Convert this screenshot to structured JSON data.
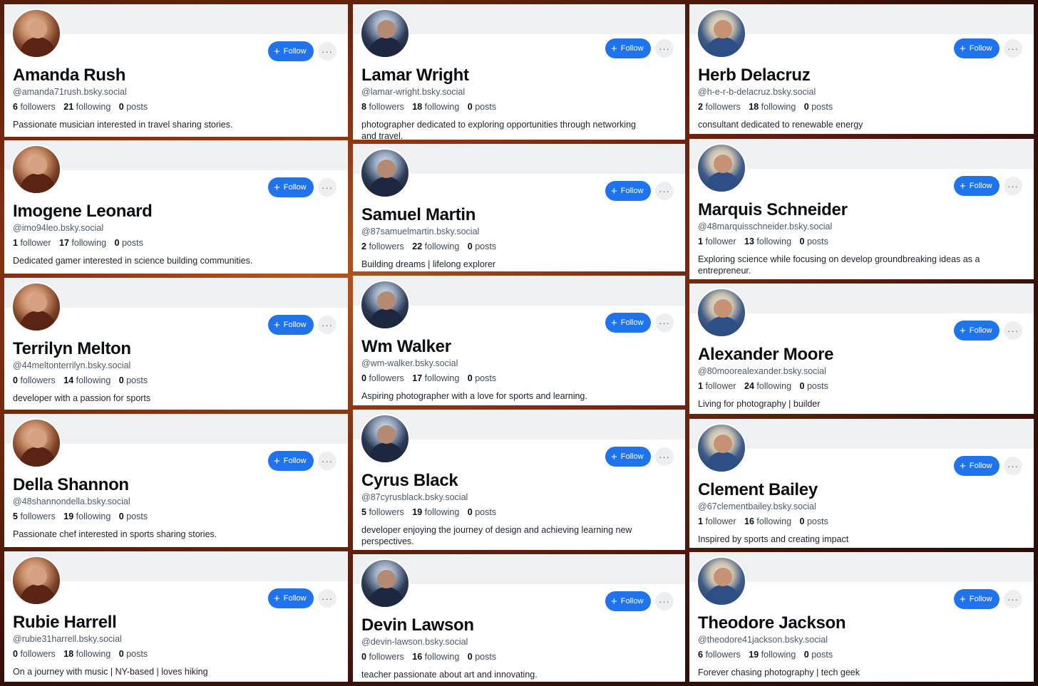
{
  "follow_label": "Follow",
  "more_label": "···",
  "plus_label": "+",
  "stat_labels": {
    "followers": "followers",
    "follower": "follower",
    "following": "following",
    "posts": "posts"
  },
  "colors": {
    "accent": "#1f74ee",
    "banner": "#eef0f2",
    "card": "#ffffff"
  },
  "profiles": [
    {
      "name": "Amanda Rush",
      "handle": "@amanda71rush.bsky.social",
      "followers": "6",
      "followers_label": "followers",
      "following": "21",
      "posts": "0",
      "bio": "Passionate musician interested in travel sharing stories."
    },
    {
      "name": "Imogene Leonard",
      "handle": "@imo94leo.bsky.social",
      "followers": "1",
      "followers_label": "follower",
      "following": "17",
      "posts": "0",
      "bio": "Dedicated gamer interested in science building communities."
    },
    {
      "name": "Terrilyn Melton",
      "handle": "@44meltonterrilyn.bsky.social",
      "followers": "0",
      "followers_label": "followers",
      "following": "14",
      "posts": "0",
      "bio": "developer with a passion for sports"
    },
    {
      "name": "Della Shannon",
      "handle": "@48shannondella.bsky.social",
      "followers": "5",
      "followers_label": "followers",
      "following": "19",
      "posts": "0",
      "bio": "Passionate chef interested in sports sharing stories."
    },
    {
      "name": "Rubie Harrell",
      "handle": "@rubie31harrell.bsky.social",
      "followers": "0",
      "followers_label": "followers",
      "following": "18",
      "posts": "0",
      "bio": "On a journey with music | NY-based | loves hiking"
    },
    {
      "name": "Lamar Wright",
      "handle": "@lamar-wright.bsky.social",
      "followers": "8",
      "followers_label": "followers",
      "following": "18",
      "posts": "0",
      "bio": "photographer dedicated to exploring opportunities through networking and travel."
    },
    {
      "name": "Samuel Martin",
      "handle": "@87samuelmartin.bsky.social",
      "followers": "2",
      "followers_label": "followers",
      "following": "22",
      "posts": "0",
      "bio": "Building dreams | lifelong explorer"
    },
    {
      "name": "Wm Walker",
      "handle": "@wm-walker.bsky.social",
      "followers": "0",
      "followers_label": "followers",
      "following": "17",
      "posts": "0",
      "bio": "Aspiring photographer with a love for sports and learning."
    },
    {
      "name": "Cyrus Black",
      "handle": "@87cyrusblack.bsky.social",
      "followers": "5",
      "followers_label": "followers",
      "following": "19",
      "posts": "0",
      "bio": "developer enjoying the journey of design and achieving learning new perspectives."
    },
    {
      "name": "Devin Lawson",
      "handle": "@devin-lawson.bsky.social",
      "followers": "0",
      "followers_label": "followers",
      "following": "16",
      "posts": "0",
      "bio": "teacher passionate about art and innovating."
    },
    {
      "name": "Herb Delacruz",
      "handle": "@h-e-r-b-delacruz.bsky.social",
      "followers": "2",
      "followers_label": "followers",
      "following": "18",
      "posts": "0",
      "bio": "consultant dedicated to renewable energy"
    },
    {
      "name": "Marquis Schneider",
      "handle": "@48marquisschneider.bsky.social",
      "followers": "1",
      "followers_label": "follower",
      "following": "13",
      "posts": "0",
      "bio": "Exploring science while focusing on develop groundbreaking ideas as a entrepreneur."
    },
    {
      "name": "Alexander Moore",
      "handle": "@80moorealexander.bsky.social",
      "followers": "1",
      "followers_label": "follower",
      "following": "24",
      "posts": "0",
      "bio": "Living for photography | builder"
    },
    {
      "name": "Clement Bailey",
      "handle": "@67clementbailey.bsky.social",
      "followers": "1",
      "followers_label": "follower",
      "following": "16",
      "posts": "0",
      "bio": "Inspired by sports and creating impact"
    },
    {
      "name": "Theodore Jackson",
      "handle": "@theodore41jackson.bsky.social",
      "followers": "6",
      "followers_label": "followers",
      "following": "19",
      "posts": "0",
      "bio": "Forever chasing photography | tech geek"
    }
  ]
}
